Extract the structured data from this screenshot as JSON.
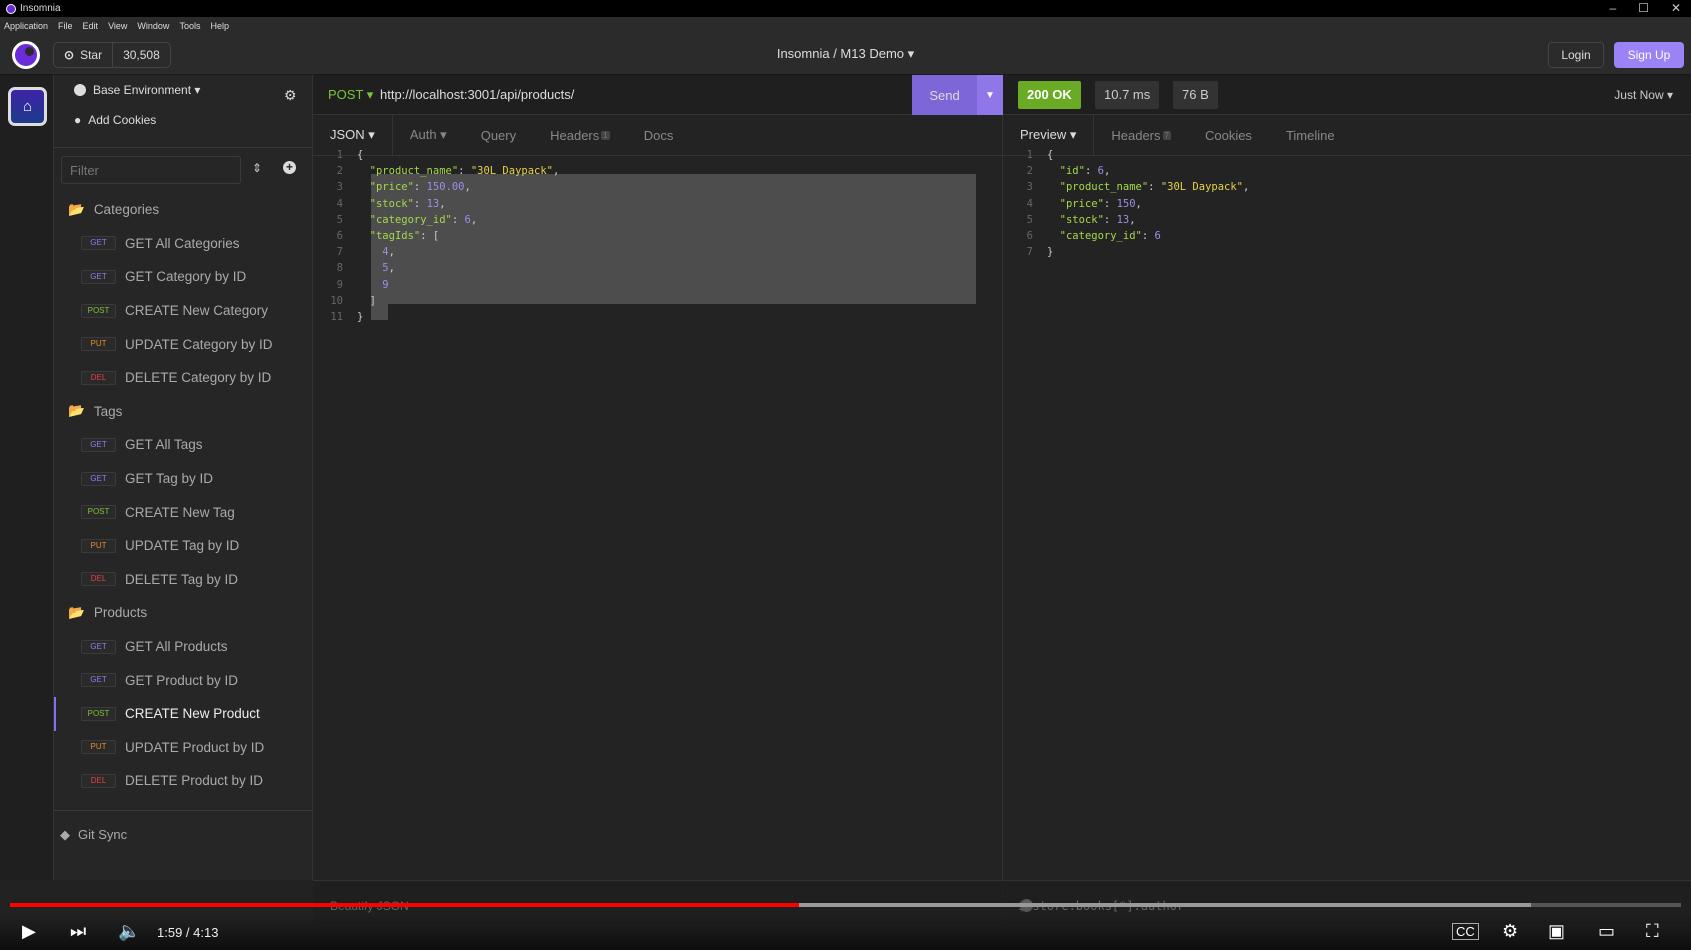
{
  "window": {
    "title": "Insomnia",
    "controls": [
      "–",
      "☐",
      "✕"
    ]
  },
  "menu": [
    "Application",
    "File",
    "Edit",
    "View",
    "Window",
    "Tools",
    "Help"
  ],
  "header": {
    "star_label": "Star",
    "star_count": "30,508",
    "breadcrumb": "Insomnia  /  M13 Demo ▾",
    "login": "Login",
    "signup": "Sign Up"
  },
  "sidebar": {
    "environment": "Base Environment ▾",
    "cookies": "Add Cookies",
    "filter_placeholder": "Filter",
    "groups": [
      {
        "name": "Categories",
        "items": [
          {
            "method": "GET",
            "label": "GET All Categories"
          },
          {
            "method": "GET",
            "label": "GET Category by ID"
          },
          {
            "method": "POST",
            "label": "CREATE New Category"
          },
          {
            "method": "PUT",
            "label": "UPDATE Category by ID"
          },
          {
            "method": "DEL",
            "label": "DELETE Category by ID"
          }
        ]
      },
      {
        "name": "Tags",
        "items": [
          {
            "method": "GET",
            "label": "GET All Tags"
          },
          {
            "method": "GET",
            "label": "GET Tag by ID"
          },
          {
            "method": "POST",
            "label": "CREATE New Tag"
          },
          {
            "method": "PUT",
            "label": "UPDATE Tag by ID"
          },
          {
            "method": "DEL",
            "label": "DELETE Tag by ID"
          }
        ]
      },
      {
        "name": "Products",
        "items": [
          {
            "method": "GET",
            "label": "GET All Products"
          },
          {
            "method": "GET",
            "label": "GET Product by ID"
          },
          {
            "method": "POST",
            "label": "CREATE New Product",
            "active": true
          },
          {
            "method": "PUT",
            "label": "UPDATE Product by ID"
          },
          {
            "method": "DEL",
            "label": "DELETE Product by ID"
          }
        ]
      }
    ],
    "git_sync": "Git Sync"
  },
  "method_colors": {
    "GET": "#8a7ef0",
    "POST": "#7cc43a",
    "PUT": "#e88a2e",
    "DEL": "#e0443c"
  },
  "request": {
    "method": "POST ▾",
    "url": "http://localhost:3001/api/products/",
    "send": "Send",
    "tabs": [
      {
        "label": "JSON ▾"
      },
      {
        "label": "Auth ▾"
      },
      {
        "label": "Query"
      },
      {
        "label": "Headers",
        "count": "1"
      },
      {
        "label": "Docs"
      }
    ],
    "body_lines": [
      [
        [
          "p",
          "{"
        ]
      ],
      [
        [
          "k",
          "\"product_name\""
        ],
        [
          "p",
          ": "
        ],
        [
          "s",
          "\"30L Daypack\""
        ],
        [
          "p",
          ","
        ]
      ],
      [
        [
          "k",
          "\"price\""
        ],
        [
          "p",
          ": "
        ],
        [
          "n",
          "150.00"
        ],
        [
          "p",
          ","
        ]
      ],
      [
        [
          "k",
          "\"stock\""
        ],
        [
          "p",
          ": "
        ],
        [
          "n",
          "13"
        ],
        [
          "p",
          ","
        ]
      ],
      [
        [
          "k",
          "\"category_id\""
        ],
        [
          "p",
          ": "
        ],
        [
          "n",
          "6"
        ],
        [
          "p",
          ","
        ]
      ],
      [
        [
          "k",
          "\"tagIds\""
        ],
        [
          "p",
          ": ["
        ]
      ],
      [
        [
          "n",
          "  4"
        ],
        [
          "p",
          ","
        ]
      ],
      [
        [
          "n",
          "  5"
        ],
        [
          "p",
          ","
        ]
      ],
      [
        [
          "n",
          "  9"
        ]
      ],
      [
        [
          "p",
          "]"
        ]
      ],
      [
        [
          "p",
          "}"
        ]
      ]
    ],
    "footer": "Beautify JSON"
  },
  "response": {
    "status": "200 OK",
    "time": "10.7 ms",
    "size": "76 B",
    "when": "Just Now ▾",
    "tabs": [
      {
        "label": "Preview ▾"
      },
      {
        "label": "Headers",
        "count": "7"
      },
      {
        "label": "Cookies"
      },
      {
        "label": "Timeline"
      }
    ],
    "body_lines": [
      [
        [
          "p",
          "{"
        ]
      ],
      [
        [
          "k",
          "\"id\""
        ],
        [
          "p",
          ": "
        ],
        [
          "n",
          "6"
        ],
        [
          "p",
          ","
        ]
      ],
      [
        [
          "k",
          "\"product_name\""
        ],
        [
          "p",
          ": "
        ],
        [
          "s",
          "\"30L Daypack\""
        ],
        [
          "p",
          ","
        ]
      ],
      [
        [
          "k",
          "\"price\""
        ],
        [
          "p",
          ": "
        ],
        [
          "n",
          "150"
        ],
        [
          "p",
          ","
        ]
      ],
      [
        [
          "k",
          "\"stock\""
        ],
        [
          "p",
          ": "
        ],
        [
          "n",
          "13"
        ],
        [
          "p",
          ","
        ]
      ],
      [
        [
          "k",
          "\"category_id\""
        ],
        [
          "p",
          ": "
        ],
        [
          "n",
          "6"
        ]
      ],
      [
        [
          "p",
          "}"
        ]
      ]
    ],
    "filter_placeholder": "$.store.books[*].author",
    "help": "?"
  },
  "video": {
    "time": "1:59 / 4:13",
    "progress": 0.472,
    "buffered": 0.91
  }
}
